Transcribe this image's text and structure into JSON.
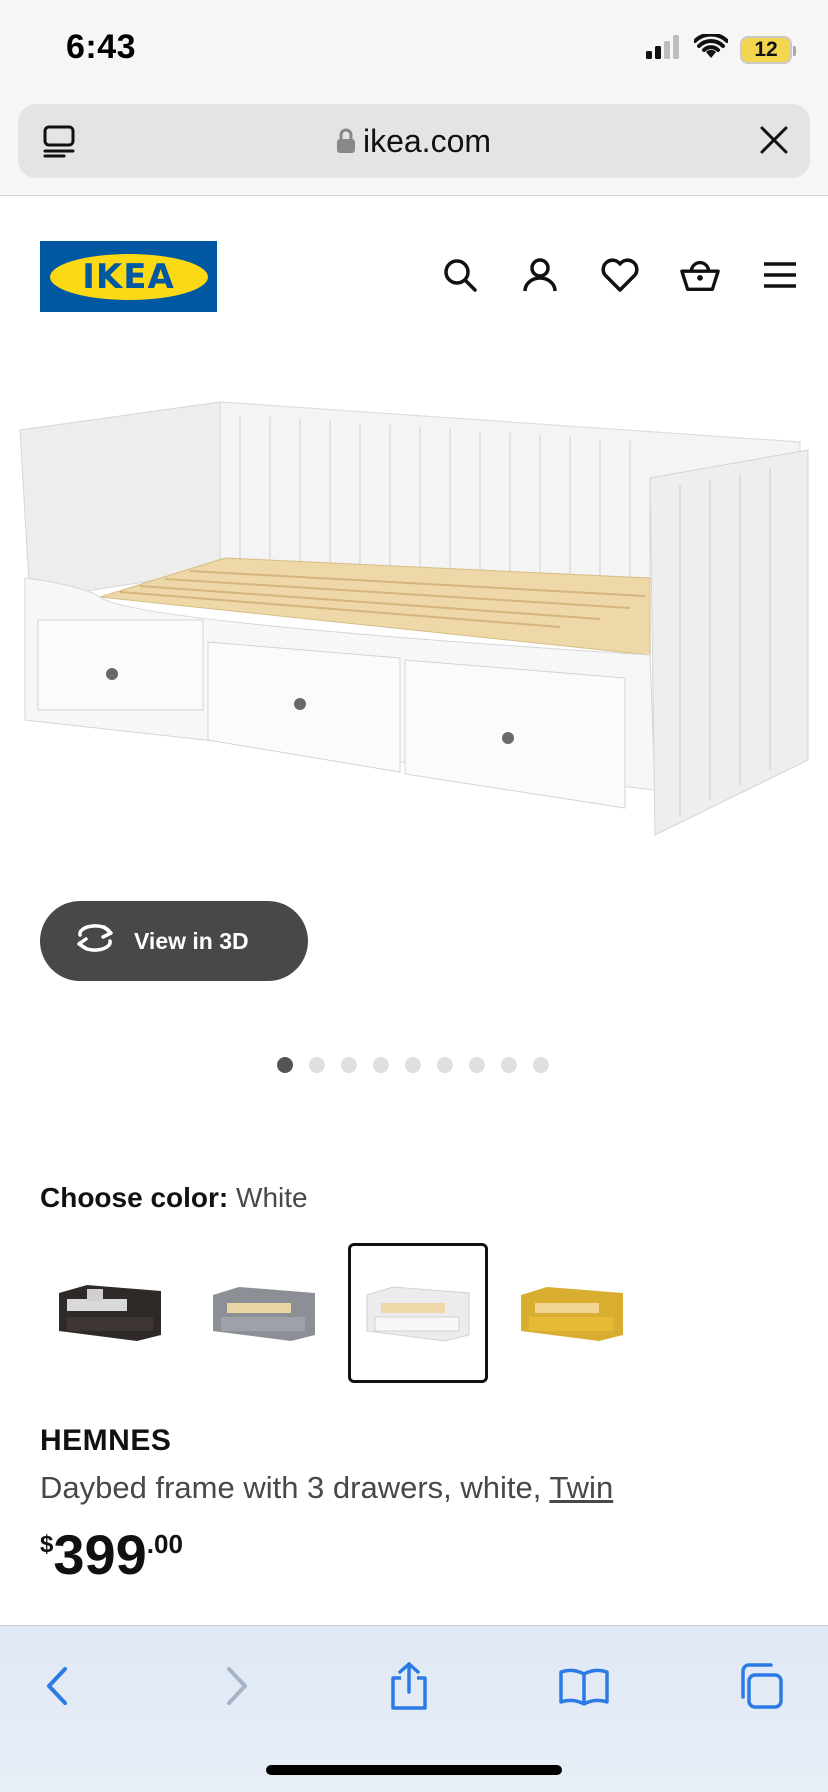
{
  "status": {
    "time": "6:43",
    "battery": "12"
  },
  "browser": {
    "url": "ikea.com"
  },
  "header": {
    "logo_text": "IKEA"
  },
  "product": {
    "view_3d_label": "View in 3D",
    "image_count": 9,
    "active_image": 1,
    "color_label": "Choose color:",
    "color_value": "White",
    "swatches": [
      {
        "name": "black-brown",
        "color": "#2f2a28",
        "selected": false
      },
      {
        "name": "gray",
        "color": "#8d8f96",
        "selected": false
      },
      {
        "name": "white",
        "color": "#f2f2f2",
        "selected": true
      },
      {
        "name": "yellow",
        "color": "#e0b430",
        "selected": false
      }
    ],
    "name": "HEMNES",
    "description": "Daybed frame with 3 drawers, white,",
    "size_link": "Twin",
    "price_currency": "$",
    "price_integer": "399",
    "price_decimal": ".00"
  },
  "toolbar": {
    "items": [
      "back",
      "forward",
      "share",
      "bookmarks",
      "tabs"
    ]
  },
  "colors": {
    "ikea_blue": "#0058a3",
    "ikea_yellow": "#fbd914",
    "safari_blue": "#2c7be5"
  }
}
